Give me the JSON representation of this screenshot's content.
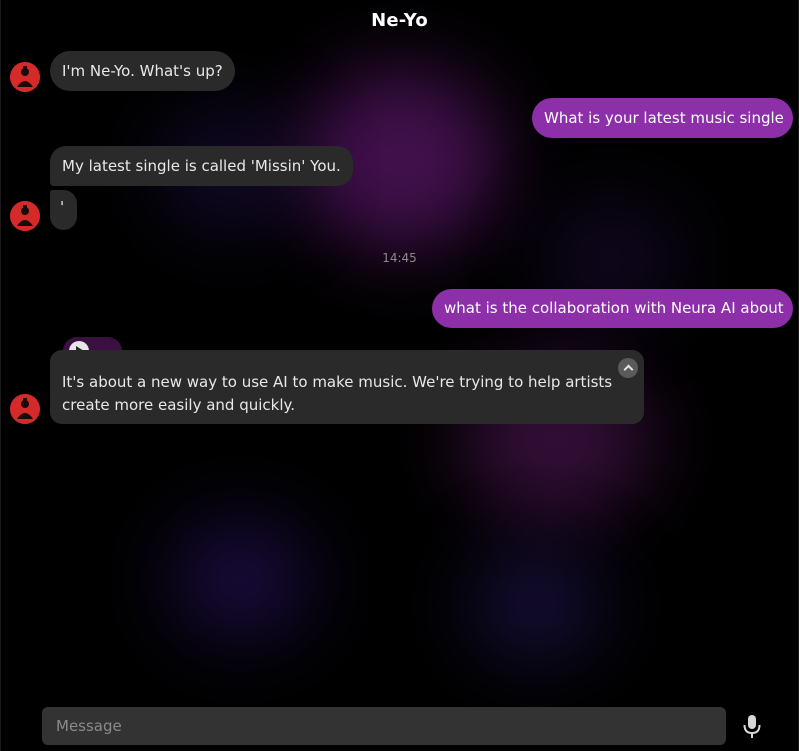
{
  "header": {
    "title": "Ne-Yo"
  },
  "messages": [
    {
      "sender": "bot",
      "text": "I'm Ne-Yo. What's up?"
    },
    {
      "sender": "user",
      "text": "What is your latest music single"
    },
    {
      "sender": "bot",
      "text": "My latest single is called 'Missin' You."
    },
    {
      "sender": "bot",
      "text": "'"
    },
    {
      "sender": "user",
      "text": "what is the collaboration with Neura AI about"
    },
    {
      "sender": "bot",
      "text": "It's about a new way to use AI to make music. We're trying to help artists create more easily and quickly."
    }
  ],
  "timestamp": "14:45",
  "composer": {
    "placeholder": "Message"
  },
  "colors": {
    "user_bubble": "#8c2fa8",
    "bot_bubble": "#2a2a2a",
    "avatar": "#d42a2a"
  },
  "icons": [
    "play-icon",
    "collapse-icon",
    "microphone-icon",
    "avatar-icon"
  ]
}
